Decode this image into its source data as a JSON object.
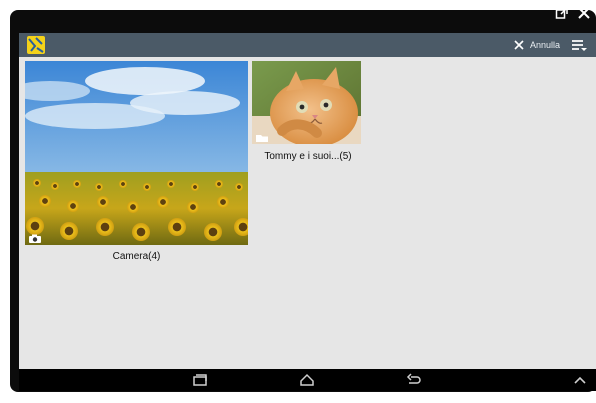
{
  "header": {
    "cancel_label": "Annulla"
  },
  "albums": [
    {
      "name": "Camera(4)"
    },
    {
      "name": "Tommy e i suoi...(5)"
    }
  ],
  "colors": {
    "topbar": "#4b5a67",
    "content_background": "#e6e6e6",
    "accent_yellow": "#f4d21a"
  },
  "icons": {
    "window_controls": [
      "popout-icon",
      "close-icon"
    ],
    "header": [
      "app-icon",
      "close-icon",
      "menu-icon"
    ],
    "album_badges": [
      "camera-icon",
      "folder-icon"
    ],
    "navbar": [
      "recent-apps-icon",
      "home-icon",
      "back-icon",
      "chevron-up-icon"
    ]
  }
}
